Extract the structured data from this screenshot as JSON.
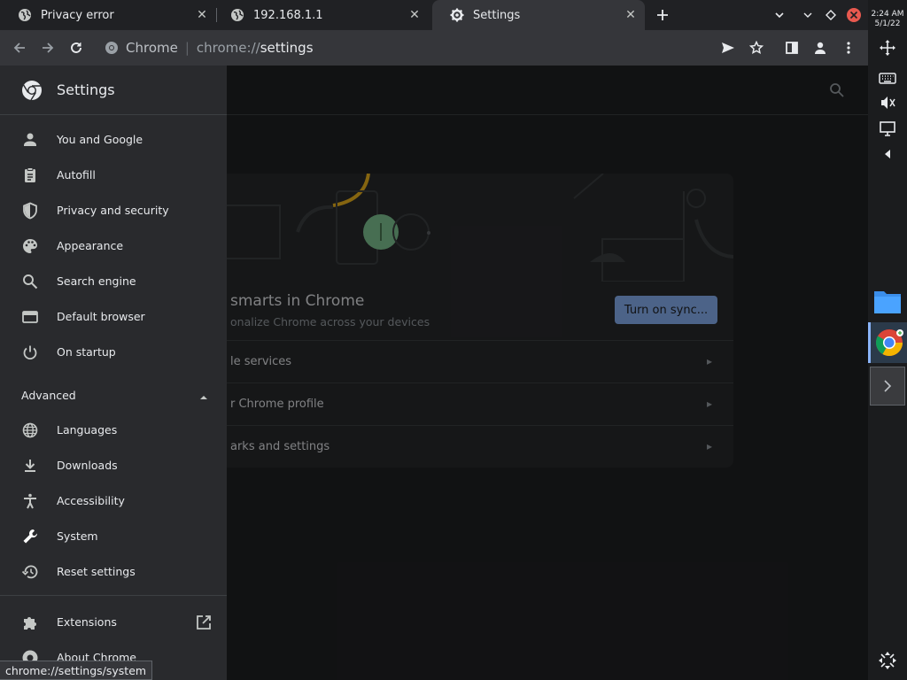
{
  "tabs": [
    {
      "title": "Privacy error",
      "favicon": "globe-icon",
      "active": false
    },
    {
      "title": "192.168.1.1",
      "favicon": "globe-icon",
      "active": false
    },
    {
      "title": "Settings",
      "favicon": "gear-icon",
      "active": true
    }
  ],
  "toolbar": {
    "omnibox_label": "Chrome",
    "url_prefix": "chrome://",
    "url_path": "settings"
  },
  "drawer": {
    "title": "Settings",
    "items": [
      {
        "label": "You and Google",
        "icon": "person-icon"
      },
      {
        "label": "Autofill",
        "icon": "clipboard-icon"
      },
      {
        "label": "Privacy and security",
        "icon": "shield-icon"
      },
      {
        "label": "Appearance",
        "icon": "palette-icon"
      },
      {
        "label": "Search engine",
        "icon": "search-icon"
      },
      {
        "label": "Default browser",
        "icon": "browser-window-icon"
      },
      {
        "label": "On startup",
        "icon": "power-icon"
      }
    ],
    "advanced_label": "Advanced",
    "advanced_items": [
      {
        "label": "Languages",
        "icon": "globe-icon"
      },
      {
        "label": "Downloads",
        "icon": "download-icon"
      },
      {
        "label": "Accessibility",
        "icon": "accessibility-icon"
      },
      {
        "label": "System",
        "icon": "wrench-icon"
      },
      {
        "label": "Reset settings",
        "icon": "history-icon"
      }
    ],
    "extensions_label": "Extensions",
    "about_label": "About Chrome"
  },
  "sync_card": {
    "title_fragment": "smarts in Chrome",
    "subtitle_fragment": "onalize Chrome across your devices",
    "button_label": "Turn on sync...",
    "rows": [
      "le services",
      "r Chrome profile",
      "arks and settings"
    ]
  },
  "status_bar": {
    "url": "chrome://settings/system"
  },
  "shelf": {
    "time": "2:24 AM",
    "date": "5/1/22"
  },
  "colors": {
    "accent": "#8ab4f8",
    "background": "#202124",
    "drawer": "#292a2d"
  }
}
